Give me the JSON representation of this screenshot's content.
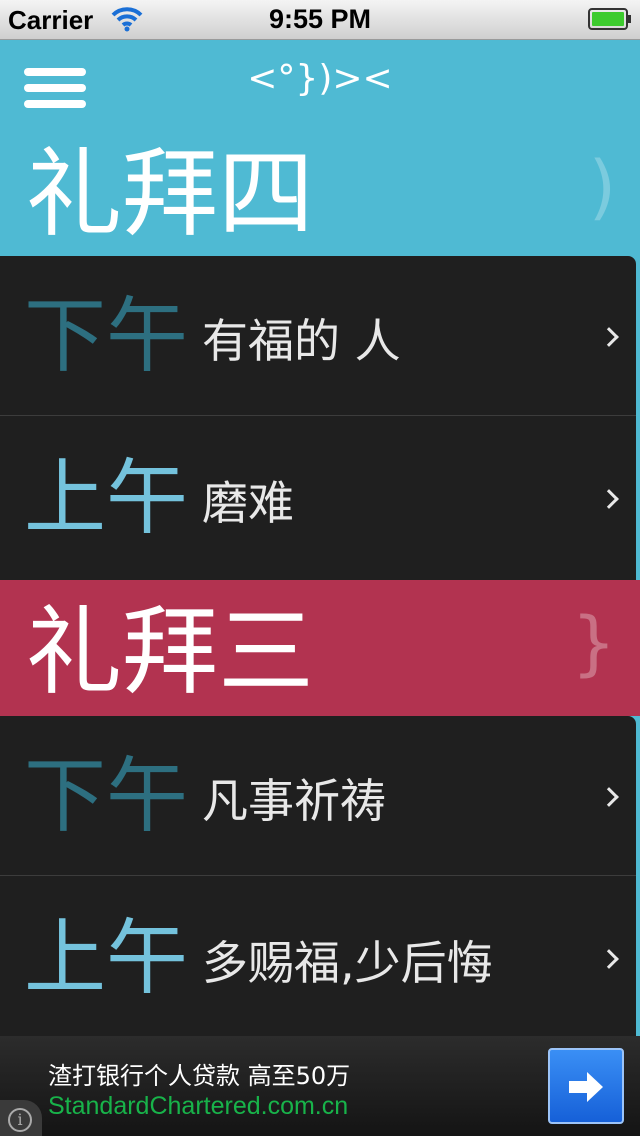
{
  "status_bar": {
    "carrier": "Carrier",
    "time": "9:55 PM"
  },
  "nav": {
    "logo_text": "<°})><",
    "menu_icon": "hamburger-menu-icon"
  },
  "days": [
    {
      "title": "礼拜四",
      "brace": ")",
      "color": "#4fbad3",
      "sermons": [
        {
          "period": "下午",
          "title": "有福的 人"
        },
        {
          "period": "上午",
          "title": "磨难"
        }
      ]
    },
    {
      "title": "礼拜三",
      "brace": "}",
      "color": "#b23350",
      "sermons": [
        {
          "period": "下午",
          "title": "凡事祈祷"
        },
        {
          "period": "上午",
          "title": "多赐福,少后悔"
        }
      ]
    }
  ],
  "ad": {
    "title": "渣打银行个人贷款 高至50万",
    "link": "StandardChartered.com.cn",
    "button_icon": "arrow-right-icon",
    "info_icon": "info-icon"
  },
  "colors": {
    "accent_blue": "#4fbad3",
    "accent_red": "#b23350",
    "card_bg": "#1f1f1f",
    "pm_text": "#2d6f80",
    "am_text": "#74c2dc",
    "ad_link": "#18b34a"
  }
}
